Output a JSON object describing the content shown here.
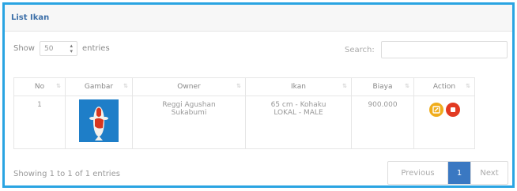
{
  "panel": {
    "title": "List Ikan"
  },
  "controls": {
    "show_label": "Show",
    "entries_value": "50",
    "entries_suffix": "entries",
    "search_label": "Search:"
  },
  "table": {
    "columns": [
      "No",
      "Gambar",
      "Owner",
      "Ikan",
      "Biaya",
      "Action"
    ],
    "rows": [
      {
        "no": "1",
        "owner_line1": "Reggi Agushan",
        "owner_line2": "Sukabumi",
        "ikan_line1": "65 cm - Kohaku",
        "ikan_line2": "LOKAL - MALE",
        "biaya": "900.000"
      }
    ]
  },
  "footer": {
    "info": "Showing 1 to 1 of 1 entries",
    "prev": "Previous",
    "page": "1",
    "next": "Next"
  },
  "colors": {
    "frame": "#2aa4e2",
    "title": "#3c6fa8",
    "edit_button": "#f0ad1c",
    "delete_button": "#e23a22",
    "active_page": "#3a78c2"
  },
  "icons": {
    "edit": "edit-icon",
    "delete": "delete-icon",
    "sort": "sort-icon",
    "select_arrows": "select-arrows-icon"
  }
}
